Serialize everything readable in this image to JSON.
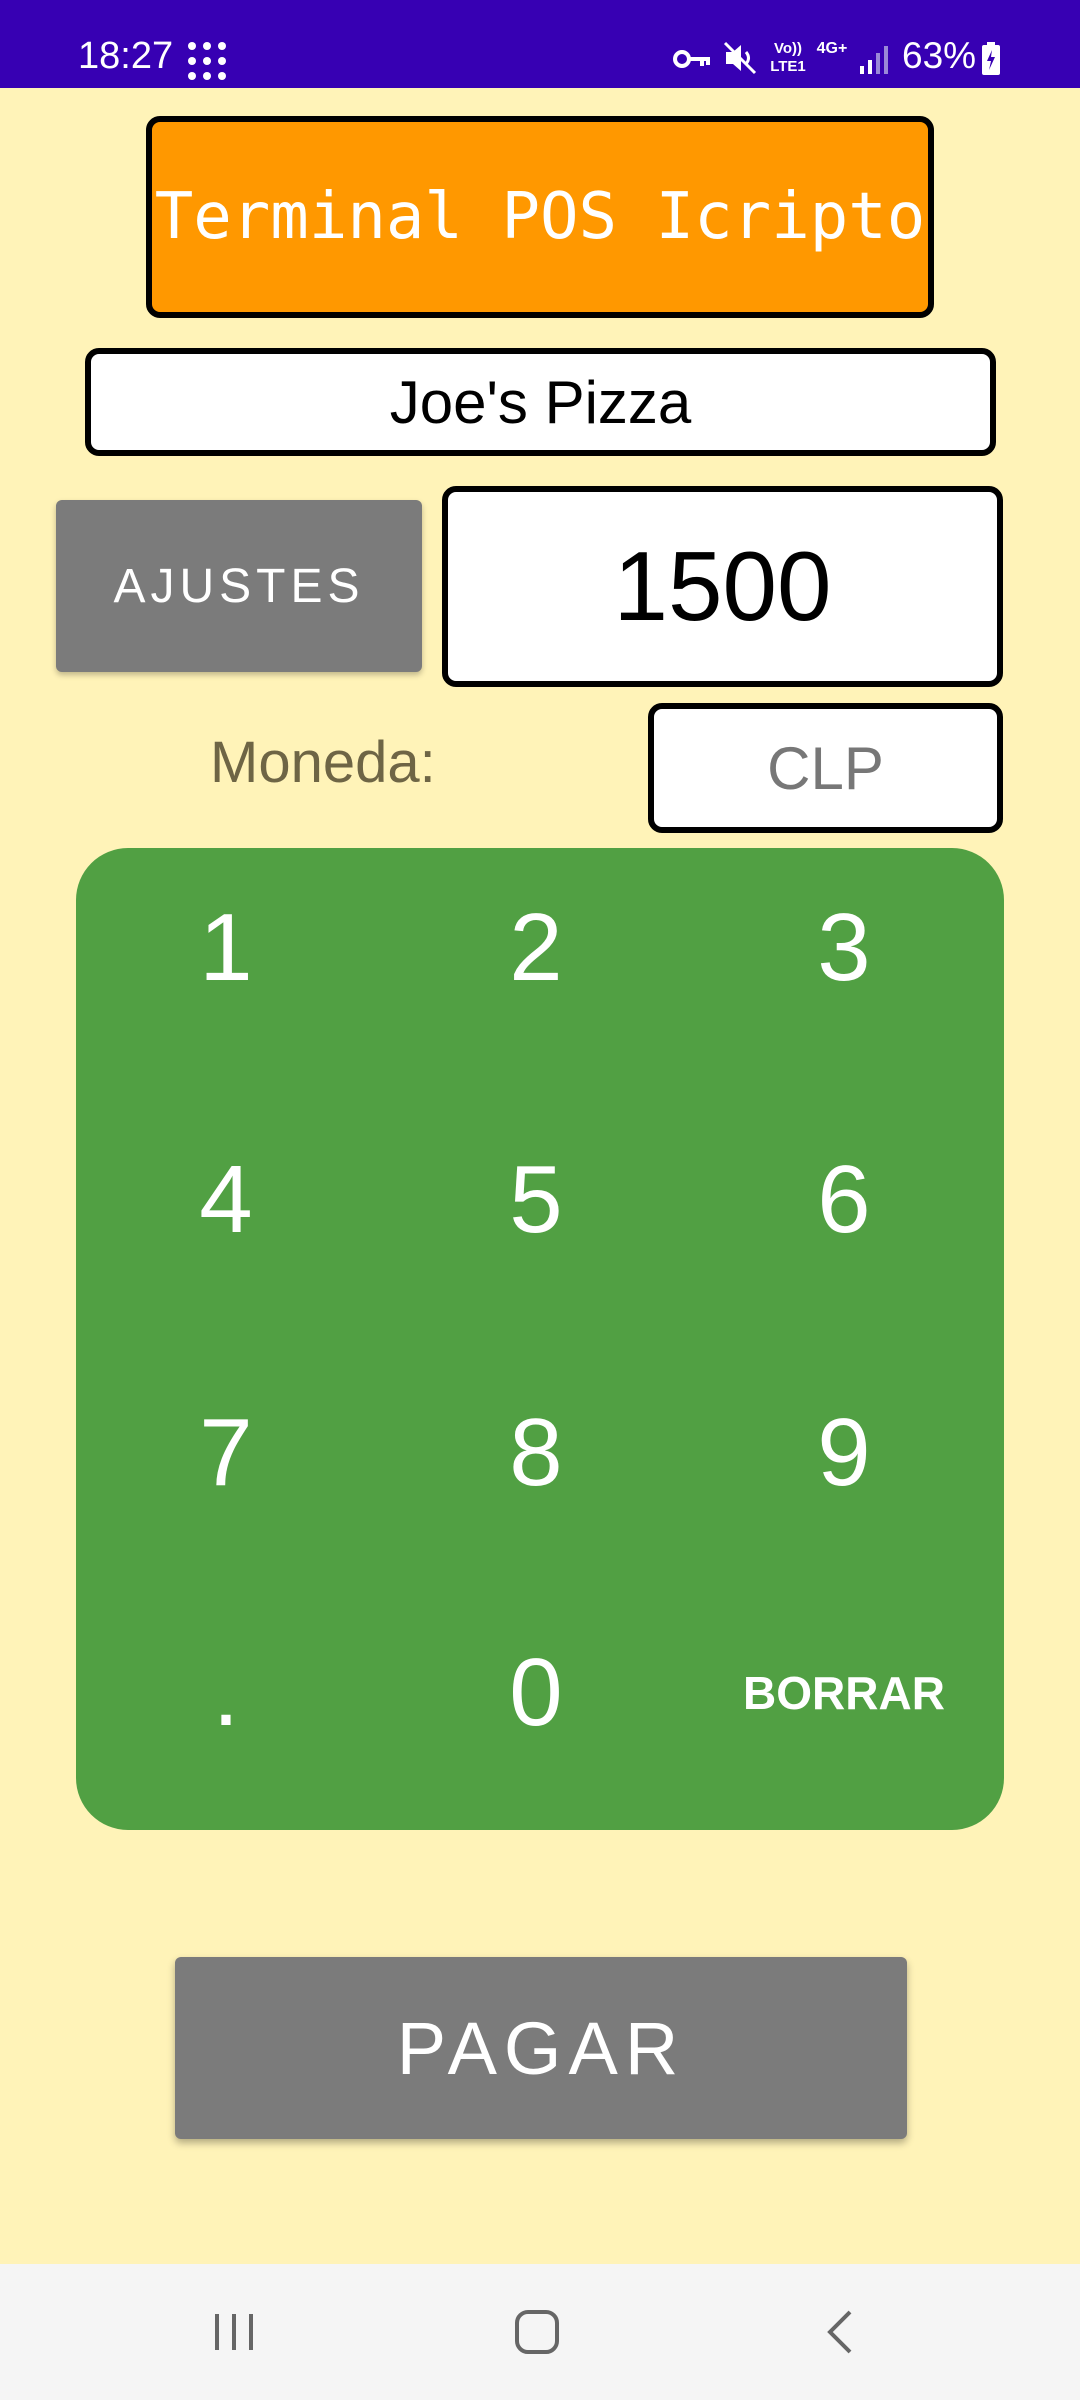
{
  "status_bar": {
    "time": "18:27",
    "volte": "Vo)) LTE1",
    "network": "4G+",
    "battery": "63%"
  },
  "header": {
    "title": "Terminal POS Icripto"
  },
  "merchant": {
    "name": "Joe's Pizza"
  },
  "settings": {
    "label": "AJUSTES"
  },
  "amount": {
    "value": "1500"
  },
  "currency": {
    "label": "Moneda:",
    "value": "CLP"
  },
  "keypad": {
    "keys": [
      "1",
      "2",
      "3",
      "4",
      "5",
      "6",
      "7",
      "8",
      "9",
      ".",
      "0",
      "BORRAR"
    ]
  },
  "pay": {
    "label": "PAGAR"
  },
  "colors": {
    "status_bar": "#3700b3",
    "background": "#fff3b8",
    "title_bg": "#ff9800",
    "keypad_bg": "#51a043",
    "button_gray": "#7b7b7b"
  },
  "icons": {
    "status": [
      "apps-grid-icon",
      "vpn-key-icon",
      "mute-icon",
      "signal-icon",
      "battery-icon"
    ],
    "nav": [
      "recent-apps-icon",
      "home-icon",
      "back-icon"
    ]
  }
}
